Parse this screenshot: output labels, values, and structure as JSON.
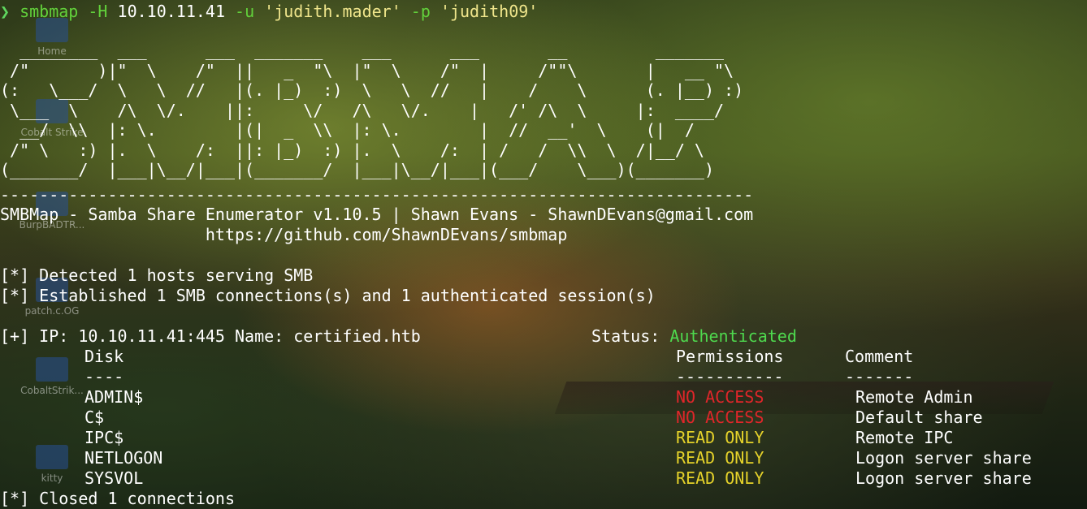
{
  "desktop": {
    "items": [
      {
        "label": "Home"
      },
      {
        "label": "Cobalt Strike"
      },
      {
        "label": "BurpBADTR..."
      },
      {
        "label": "patch.c.OG"
      },
      {
        "label": "CobaltStrik..."
      },
      {
        "label": "kitty"
      }
    ]
  },
  "prompt": {
    "symbol": "❯",
    "command": "smbmap",
    "flag_host": "-H",
    "host": "10.10.11.41",
    "flag_user": "-u",
    "user": "'judith.mader'",
    "flag_pass": "-p",
    "password": "'judith09'"
  },
  "banner": {
    "ascii_lines": [
      "  ________  ___      ___  _______    ___      ___       __         _______",
      " /\"       )|\"  \\    /\"  ||   _  \"\\  |\"  \\    /\"  |     /\"\"\\       |   __ \"\\",
      "(:   \\___/  \\   \\  //   |(. |_)  :)  \\   \\  //   |    /    \\      (. |__) :)",
      " \\___  \\    /\\  \\/.    ||:     \\/   /\\   \\/.    |   /' /\\  \\     |:  ____/",
      "  __/  \\\\  |: \\.        |(|  _  \\\\  |: \\.        |  //  __'  \\    (|  /",
      " /\" \\   :) |.  \\    /:  ||: |_)  :) |.  \\    /:  | /   /  \\\\  \\  /|__/ \\",
      "(_______/  |___|\\__/|___|(_______/  |___|\\__/|___|(___/    \\___)(_______)"
    ],
    "separator": "-----------------------------------------------------------------------------",
    "title_line": "SMBMap - Samba Share Enumerator v1.10.5 | Shawn Evans - ShawnDEvans@gmail.com",
    "url_line": "                     https://github.com/ShawnDEvans/smbmap"
  },
  "output": {
    "detected": "[*] Detected 1 hosts serving SMB",
    "established": "[*] Established 1 SMB connections(s) and 1 authenticated session(s)",
    "ip_line": "[+] IP: 10.10.11.41:445 Name: certified.htb",
    "status_label": "Status:",
    "status_value": "Authenticated",
    "headers": {
      "disk": "Disk",
      "disk_underline": "----",
      "permissions": "Permissions",
      "permissions_underline": "-----------",
      "comment": "Comment",
      "comment_underline": "-------"
    },
    "shares": [
      {
        "disk": "ADMIN$",
        "permission": "NO ACCESS",
        "comment": "Remote Admin",
        "color": "#e0262a"
      },
      {
        "disk": "C$",
        "permission": "NO ACCESS",
        "comment": "Default share",
        "color": "#e0262a"
      },
      {
        "disk": "IPC$",
        "permission": "READ ONLY",
        "comment": "Remote IPC",
        "color": "#e5d22a"
      },
      {
        "disk": "NETLOGON",
        "permission": "READ ONLY",
        "comment": "Logon server share",
        "color": "#e5d22a"
      },
      {
        "disk": "SYSVOL",
        "permission": "READ ONLY",
        "comment": "Logon server share",
        "color": "#e5d22a"
      }
    ],
    "closed": "[*] Closed 1 connections"
  },
  "colors": {
    "authenticated": "#4ed94e",
    "no_access": "#e0262a",
    "read_only": "#e5d22a"
  }
}
